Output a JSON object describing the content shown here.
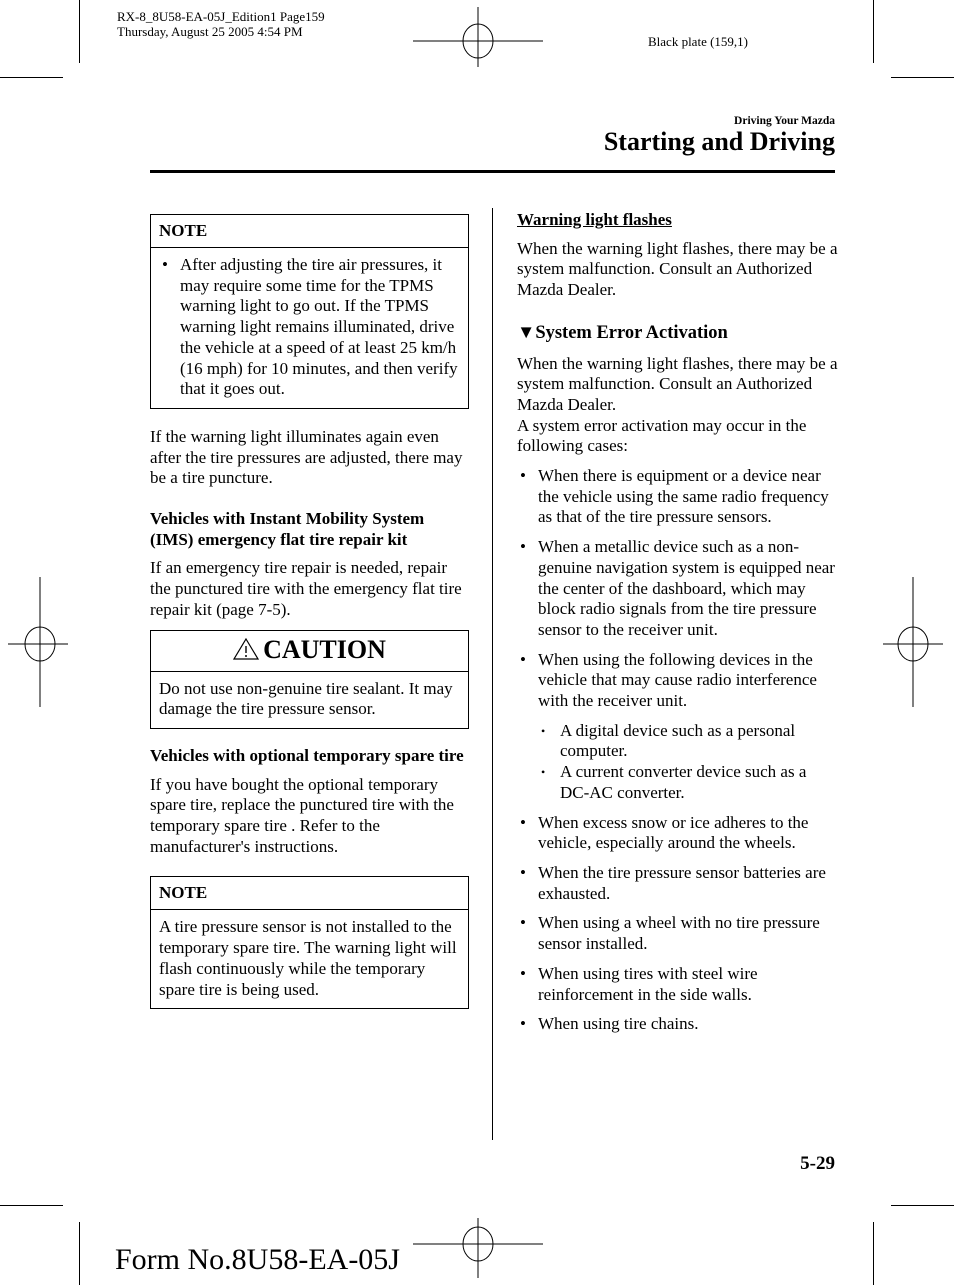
{
  "print_meta": {
    "line1": "RX-8_8U58-EA-05J_Edition1 Page159",
    "line2": "Thursday, August 25 2005 4:54 PM",
    "plate": "Black plate (159,1)"
  },
  "header": {
    "chapter": "Driving Your Mazda",
    "section": "Starting and Driving"
  },
  "left_column": {
    "note1": {
      "heading": "NOTE",
      "bullets": [
        "After adjusting the tire air pressures, it may require some time for the TPMS warning light to go out. If the TPMS warning light remains illuminated, drive the vehicle at a speed of at least 25 km/h (16 mph) for 10 minutes, and then verify that it goes out."
      ]
    },
    "para1": "If the warning light illuminates again even after the tire pressures are adjusted, there may be a tire puncture.",
    "ims_heading": "Vehicles with Instant Mobility System (IMS) emergency flat tire repair kit",
    "ims_text": "If an emergency tire repair is needed, repair the punctured tire with the emergency flat tire repair kit (page 7-5).",
    "caution": {
      "icon": "warning-triangle-icon",
      "heading": "CAUTION",
      "text": "Do not use non-genuine tire sealant. It may damage the tire pressure sensor."
    },
    "spare_heading": "Vehicles with optional temporary spare tire",
    "spare_text": "If you have bought the optional temporary spare tire, replace the punctured tire with the temporary spare tire . Refer to the manufacturer's instructions.",
    "note2": {
      "heading": "NOTE",
      "text": "A tire pressure sensor is not installed to the temporary spare tire. The warning light will flash continuously while the temporary spare tire is being used."
    }
  },
  "right_column": {
    "flash_heading": "Warning light flashes",
    "flash_text": "When the warning light flashes, there may be a system malfunction. Consult an Authorized Mazda Dealer.",
    "sea_marker": "▼",
    "sea_heading": "System Error Activation",
    "sea_text1": "When the warning light flashes, there may be a system malfunction. Consult an Authorized Mazda Dealer.",
    "sea_text2": "A system error activation may occur in the following cases:",
    "bullets": [
      "When there is equipment or a device near the vehicle using the same radio frequency as that of the tire pressure sensors.",
      "When a metallic device such as a non-genuine navigation system is equipped near the center of the dashboard, which may block radio signals from the tire pressure sensor to the receiver unit.",
      "When using the following devices in the vehicle that may cause radio interference with the receiver unit."
    ],
    "sub_bullets": [
      "A digital device such as a personal computer.",
      "A current converter device such as a DC-AC converter."
    ],
    "bullets2": [
      "When excess snow or ice adheres to the vehicle, especially around the wheels.",
      "When the tire pressure sensor batteries are exhausted.",
      "When using a wheel with no tire pressure sensor installed.",
      "When using tires with steel wire reinforcement in the side walls.",
      "When using tire chains."
    ]
  },
  "footer": {
    "page_number": "5-29",
    "form_number": "Form No.8U58-EA-05J"
  }
}
